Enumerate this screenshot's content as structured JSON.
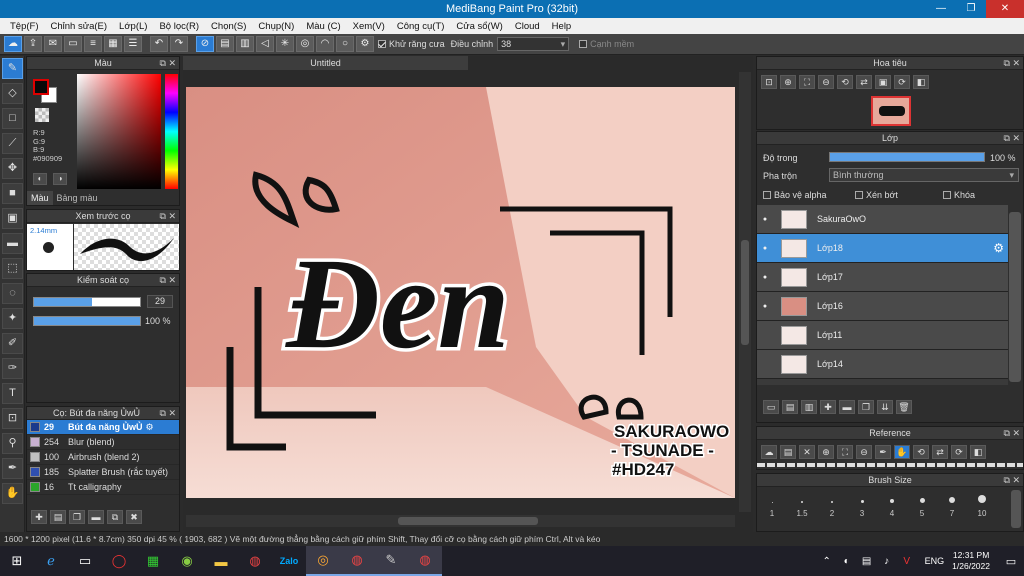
{
  "app": {
    "title": "MediBang Paint Pro (32bit)",
    "window_buttons": [
      "—",
      "❐",
      "✕"
    ]
  },
  "menu": [
    "Tệp(F)",
    "Chỉnh sửa(E)",
    "Lớp(L)",
    "Bộ lọc(R)",
    "Chọn(S)",
    "Chụp(N)",
    "Màu (C)",
    "Xem(V)",
    "Công cụ(T)",
    "Cửa sổ(W)",
    "Cloud",
    "Help"
  ],
  "toolbar": {
    "antialias_label": "Khử răng cưa",
    "adjust_label": "Điều chỉnh",
    "adjust_value": "38",
    "smooth_label": "Cạnh mềm"
  },
  "color_panel": {
    "title": "Màu",
    "r": "R:9",
    "g": "G:9",
    "b": "B:9",
    "hex": "#090909",
    "tabs": [
      "Màu",
      "Bảng màu"
    ],
    "fg": "#090909",
    "bg": "#ffffff"
  },
  "brush_preview": {
    "title": "Xem trước cọ",
    "size": "2.14mm"
  },
  "brush_control": {
    "title": "Kiểm soát cọ",
    "size_value": "29",
    "opacity_value": "100 %"
  },
  "brush_list": {
    "title": "Cọ: Bút đa năng ỦwỦ",
    "items": [
      {
        "num": "29",
        "name": "Bút đa năng ỦwỦ",
        "color": "#1a3a8c"
      },
      {
        "num": "254",
        "name": "Blur (blend)",
        "color": "#c7b0d0"
      },
      {
        "num": "100",
        "name": "Airbrush (blend 2)",
        "color": "#bfbfbf"
      },
      {
        "num": "185",
        "name": "Splatter Brush (rắc tuyết)",
        "color": "#2f4fb0"
      },
      {
        "num": "16",
        "name": "Tt calligraphy",
        "color": "#2aa52a"
      }
    ]
  },
  "canvas": {
    "tab_title": "Untitled"
  },
  "artwork": {
    "main_text": "Đen",
    "credit_line1": "SAKURAOWO",
    "credit_line2": "- TSUNADE -",
    "credit_line3": "#HD247"
  },
  "navigator": {
    "title": "Hoa tiêu"
  },
  "layers": {
    "title": "Lớp",
    "opacity_label": "Độ trong",
    "opacity_value": "100 %",
    "opacity_fraction": 1.0,
    "blend_label": "Pha trộn",
    "blend_value": "Bình thường",
    "protect_alpha": "Bảo vệ alpha",
    "clipping": "Xén bớt",
    "lock": "Khóa",
    "items": [
      {
        "name": "SakuraOwO",
        "visible": true,
        "selected": false
      },
      {
        "name": "Lớp18",
        "visible": true,
        "selected": true
      },
      {
        "name": "Lớp17",
        "visible": true,
        "selected": false
      },
      {
        "name": "Lớp16",
        "visible": true,
        "selected": false
      },
      {
        "name": "Lớp11",
        "visible": false,
        "selected": false
      },
      {
        "name": "Lớp14",
        "visible": false,
        "selected": false
      }
    ]
  },
  "reference": {
    "title": "Reference"
  },
  "brush_size": {
    "title": "Brush Size",
    "sizes": [
      "1",
      "1.5",
      "2",
      "3",
      "4",
      "5",
      "7",
      "10"
    ]
  },
  "status": {
    "text": "1600 * 1200 pixel   (11.6 * 8.7cm)   350 dpi   45 %   ( 1903, 682 )   Vẽ một đường thẳng bằng cách giữ phím Shift, Thay đổi cỡ cọ bằng cách giữ phím Ctrl, Alt và kéo"
  },
  "taskbar": {
    "lang": "ENG",
    "time": "12:31 PM",
    "date": "1/26/2022"
  },
  "colors": {
    "accent": "#2b7cd3",
    "titlebar": "#0b6fb3"
  }
}
